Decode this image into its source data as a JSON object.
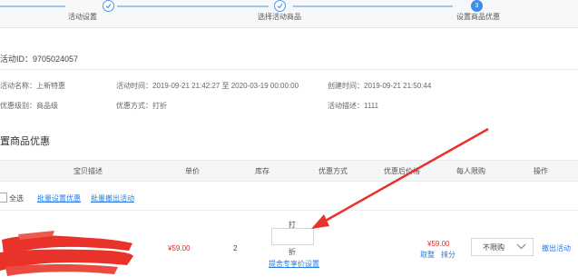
{
  "steps": [
    {
      "label": "活动设置"
    },
    {
      "label": "选择活动商品"
    },
    {
      "label": "设置商品优惠",
      "number": "3"
    }
  ],
  "activity_id": "活动ID：9705024057",
  "info": {
    "name": "活动名称：上新特惠",
    "time": "活动时间：2019-09-21 21:42:27 至 2020-03-19 00:00:00",
    "created": "创建时间：2019-09-21 21:50:44",
    "level": "优惠级别：商品级",
    "method": "优惠方式：打折",
    "desc": "活动描述：1111"
  },
  "section_title": "置商品优惠",
  "table": {
    "headers": [
      "宝贝描述",
      "单价",
      "库存",
      "优惠方式",
      "优惠后价格",
      "每人限购",
      "操作"
    ]
  },
  "bulk": {
    "select_all": "全选",
    "bulk_set": "批量设置优惠",
    "bulk_remove": "批量撤出活动"
  },
  "row": {
    "price": "¥59.00",
    "stock": "2",
    "discount_prefix": "打",
    "discount_value": "",
    "discount_suffix": "折",
    "exclusive_link": "提舍专享价设置",
    "final_price": "¥59.00",
    "round_label": "取整",
    "erase_label": "抹分",
    "limit_value": "不限购",
    "remove_link": "撤出活动"
  },
  "colors": {
    "accent": "#3a8ee6",
    "link": "#2a7ae2",
    "price": "#e22a2a",
    "annotation": "#e8322a"
  }
}
